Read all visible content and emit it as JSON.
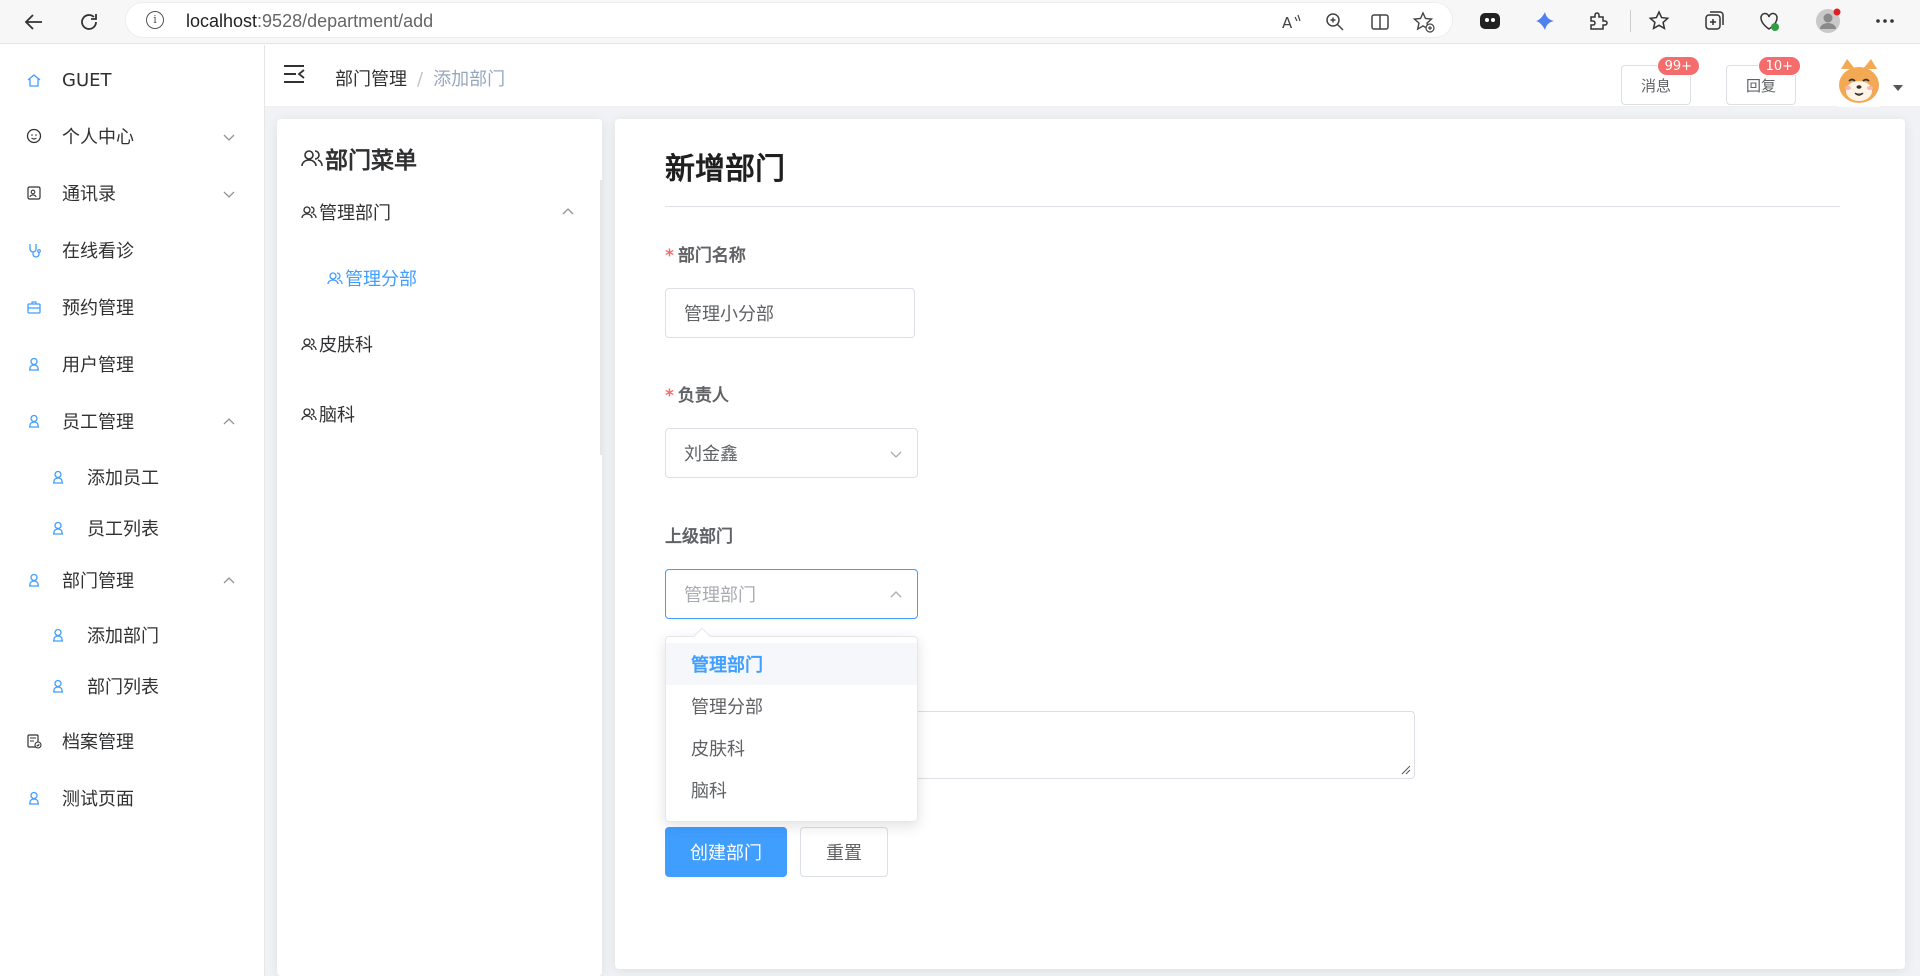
{
  "browser": {
    "url_host": "localhost",
    "url_rest": ":9528/department/add"
  },
  "sidebar": {
    "items": [
      {
        "label": "GUET",
        "icon": "home-icon",
        "arrow": ""
      },
      {
        "label": "个人中心",
        "icon": "smile-icon",
        "arrow": "down"
      },
      {
        "label": "通讯录",
        "icon": "contacts-icon",
        "arrow": "down"
      },
      {
        "label": "在线看诊",
        "icon": "stethoscope-icon",
        "arrow": ""
      },
      {
        "label": "预约管理",
        "icon": "briefcase-icon",
        "arrow": ""
      },
      {
        "label": "用户管理",
        "icon": "user-icon",
        "arrow": ""
      },
      {
        "label": "员工管理",
        "icon": "user-icon",
        "arrow": "up"
      },
      {
        "label": "添加员工",
        "icon": "user-icon",
        "arrow": ""
      },
      {
        "label": "员工列表",
        "icon": "user-icon",
        "arrow": ""
      },
      {
        "label": "部门管理",
        "icon": "user-icon",
        "arrow": "up"
      },
      {
        "label": "添加部门",
        "icon": "user-icon",
        "arrow": ""
      },
      {
        "label": "部门列表",
        "icon": "user-icon",
        "arrow": ""
      },
      {
        "label": "档案管理",
        "icon": "document-check-icon",
        "arrow": ""
      },
      {
        "label": "测试页面",
        "icon": "user-icon",
        "arrow": ""
      }
    ]
  },
  "header": {
    "breadcrumb": [
      "部门管理",
      "添加部门"
    ],
    "messages_label": "消息",
    "messages_badge": "99+",
    "reply_label": "回复",
    "reply_badge": "10+"
  },
  "dept_menu": {
    "title": "部门菜单",
    "items": [
      {
        "label": "管理部门"
      },
      {
        "label": "管理分部"
      },
      {
        "label": "皮肤科"
      },
      {
        "label": "脑科"
      }
    ]
  },
  "form": {
    "title": "新增部门",
    "name_label": "部门名称",
    "name_value": "管理小分部",
    "leader_label": "负责人",
    "leader_value": "刘金鑫",
    "parent_label": "上级部门",
    "parent_placeholder": "管理部门",
    "submit_label": "创建部门",
    "reset_label": "重置"
  },
  "dropdown": {
    "options": [
      "管理部门",
      "管理分部",
      "皮肤科",
      "脑科"
    ],
    "selected": "管理部门"
  },
  "colors": {
    "primary": "#409eff",
    "badge": "#f56c6c"
  }
}
